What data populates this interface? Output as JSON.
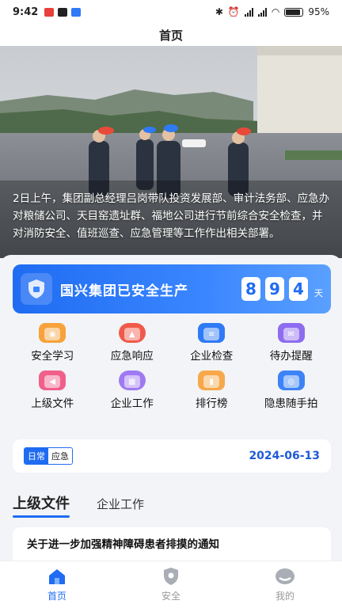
{
  "status": {
    "time": "9:42",
    "battery": "95%"
  },
  "header": {
    "title": "首页"
  },
  "banner": {
    "caption": "2日上午，集团副总经理吕岗带队投资发展部、审计法务部、应急办对粮储公司、天目窑遗址群、福地公司进行节前综合安全检查，并对消防安全、值班巡查、应急管理等工作作出相关部署。"
  },
  "safety": {
    "title": "国兴集团已安全生产",
    "digits": [
      "8",
      "9",
      "4"
    ],
    "unit": "天"
  },
  "grid": [
    {
      "label": "安全学习",
      "icon": "study-icon",
      "color": "#f7a23a"
    },
    {
      "label": "应急响应",
      "icon": "alarm-icon",
      "color": "#f05a4a"
    },
    {
      "label": "企业检查",
      "icon": "inspection-icon",
      "color": "#2f7af5"
    },
    {
      "label": "待办提醒",
      "icon": "todo-icon",
      "color": "#8e6cf0"
    },
    {
      "label": "上级文件",
      "icon": "document-icon",
      "color": "#f0608a"
    },
    {
      "label": "企业工作",
      "icon": "work-icon",
      "color": "#a07af2"
    },
    {
      "label": "排行榜",
      "icon": "ranking-icon",
      "color": "#f6a84a"
    },
    {
      "label": "隐患随手拍",
      "icon": "camera-icon",
      "color": "#3d83f6"
    }
  ],
  "date_card": {
    "segments": [
      "日常",
      "应急"
    ],
    "date": "2024-06-13"
  },
  "tabs": [
    "上级文件",
    "企业工作"
  ],
  "notice": {
    "title": "关于进一步加强精神障碍患者排摸的通知"
  },
  "bottom_nav": [
    {
      "label": "首页",
      "icon": "home-icon"
    },
    {
      "label": "安全",
      "icon": "shield-icon"
    },
    {
      "label": "我的",
      "icon": "profile-icon"
    }
  ],
  "colors": {
    "primary": "#1f6cf2",
    "date": "#1f5bd6"
  }
}
